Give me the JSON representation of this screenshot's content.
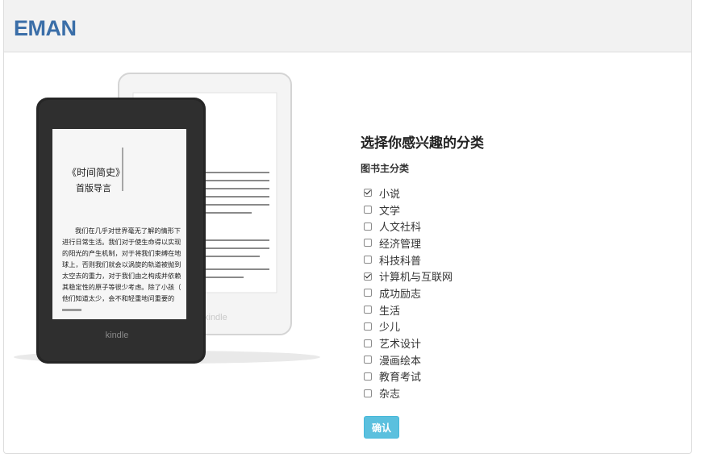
{
  "header": {
    "brand": "EMAN"
  },
  "illustration": {
    "device_label_front": "kindle",
    "device_label_back": "kindle",
    "book_title": "《时间简史》",
    "book_subtitle": "首版导言",
    "book_text": [
      "我们在几乎对世界毫无了解的情形下",
      "进行日常生活。我们对于使生命得以实现",
      "的阳光的产生机制，对于将我们束缚在地",
      "球上，否则我们就会以涡旋的轨道被抛到",
      "太空去的重力，对于我们由之构成并依赖",
      "其稳定性的原子等很少考虑。除了小孩（",
      "他们知道太少，会不和轻重地问重要的"
    ]
  },
  "form": {
    "title": "选择你感兴趣的分类",
    "section_label": "图书主分类",
    "options": [
      {
        "label": "小说",
        "checked": true
      },
      {
        "label": "文学",
        "checked": false
      },
      {
        "label": "人文社科",
        "checked": false
      },
      {
        "label": "经济管理",
        "checked": false
      },
      {
        "label": "科技科普",
        "checked": false
      },
      {
        "label": "计算机与互联网",
        "checked": true
      },
      {
        "label": "成功励志",
        "checked": false
      },
      {
        "label": "生活",
        "checked": false
      },
      {
        "label": "少儿",
        "checked": false
      },
      {
        "label": "艺术设计",
        "checked": false
      },
      {
        "label": "漫画绘本",
        "checked": false
      },
      {
        "label": "教育考试",
        "checked": false
      },
      {
        "label": "杂志",
        "checked": false
      }
    ],
    "submit_label": "确认"
  }
}
